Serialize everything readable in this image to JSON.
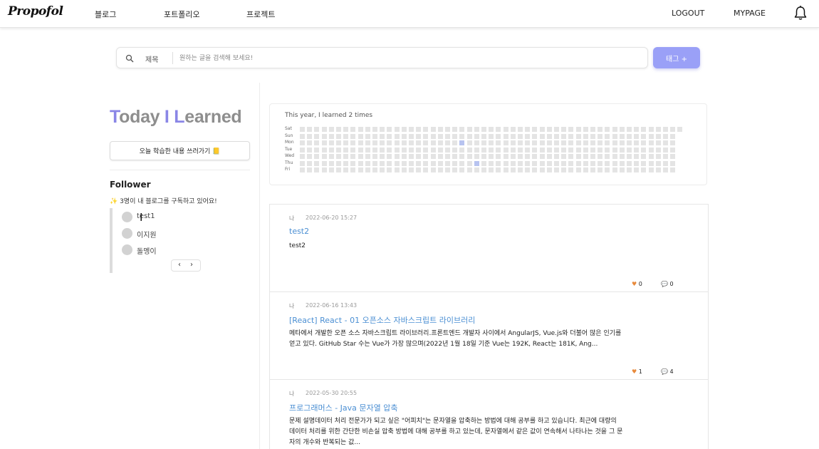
{
  "header": {
    "logo": "Propofol",
    "nav": [
      "블로그",
      "포트폴리오",
      "프로젝트"
    ],
    "logout": "LOGOUT",
    "mypage": "MYPAGE",
    "bell_icon": "bell-icon"
  },
  "search": {
    "type_label": "제목",
    "placeholder": "원하는 글을 검색해 보세요!",
    "value": "",
    "tag_button": "태그 +"
  },
  "sidebar": {
    "til_title": {
      "t": "T",
      "oday": "oday ",
      "i": "I",
      "space": " ",
      "l": "L",
      "earned": "earned"
    },
    "write_button": "오늘 학습한 내용 쓰러가기 📒",
    "follower_title": "Follower",
    "follower_sub": "✨ 3명이 내 블로그를 구독하고 있어요!",
    "followers": [
      "test1",
      "이지원",
      "돌멩이"
    ],
    "pager": {
      "prev": "‹",
      "next": "›"
    }
  },
  "heatmap": {
    "caption": "This year, I learned 2 times",
    "days": [
      "Sat",
      "Sun",
      "Mon",
      "Tue",
      "Wed",
      "Thu",
      "Fri"
    ],
    "weeks": 53,
    "active": [
      {
        "week": 22,
        "day": 2
      },
      {
        "week": 24,
        "day": 5
      }
    ]
  },
  "posts": [
    {
      "author": "나",
      "date": "2022-06-20 15:27",
      "title": "test2",
      "body": "test2",
      "likes": "0",
      "comments": "0"
    },
    {
      "author": "나",
      "date": "2022-06-16 13:43",
      "title": "[React] React - 01 오픈소스 자바스크립트 라이브러리",
      "body": "메타에서 개발한 오픈 소스 자바스크립트 라이브러리.프론트엔드 개발자 사이에서 AngularJS, Vue.js와 더불어 많은 인기를 얻고 있다. GitHub Star 수는 Vue가 가장 많으며(2022년 1월 18일 기준 Vue는 192K, React는 181K, Ang...",
      "likes": "1",
      "comments": "4"
    },
    {
      "author": "나",
      "date": "2022-05-30 20:55",
      "title": "프로그래머스 - Java 문자열 압축",
      "body": "문제 설명데이터 처리 전문가가 되고 싶은 \"어피치\"는 문자열을 압축하는 방법에 대해 공부를 하고 있습니다. 최근에 대량의 데이터 처리를 위한 간단한 비손실 압축 방법에 대해 공부를 하고 있는데, 문자열에서 같은 값이 연속해서 나타나는 것을 그 문자의 개수와 반복되는 값...",
      "likes": "",
      "comments": ""
    }
  ]
}
